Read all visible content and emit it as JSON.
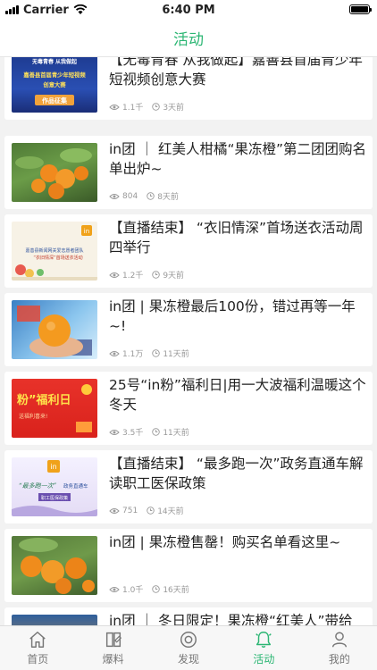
{
  "status": {
    "carrier": "Carrier",
    "time": "6:40 PM"
  },
  "nav": {
    "title": "活动"
  },
  "feed": [
    {
      "title": "【无毒青春 从我做起】嘉善县首届青少年短视频创意大赛",
      "views": "1.1千",
      "time": "3天前"
    },
    {
      "title": "in团 ｜ 红美人柑橘“果冻橙”第二团团购名单出炉~",
      "views": "804",
      "time": "8天前"
    },
    {
      "title": "【直播结束】 “衣旧情深”首场送衣活动周四举行",
      "views": "1.2千",
      "time": "9天前"
    },
    {
      "title": "in团 | 果冻橙最后100份，错过再等一年~!",
      "views": "1.1万",
      "time": "11天前"
    },
    {
      "title": "25号“in粉”福利日|用一大波福利温暖这个冬天",
      "views": "3.5千",
      "time": "11天前"
    },
    {
      "title": "【直播结束】 “最多跑一次”政务直通车解读职工医保政策",
      "views": "751",
      "time": "14天前"
    },
    {
      "title": "in团 | 果冻橙售罄！购买名单看这里~",
      "views": "1.0千",
      "time": "16天前"
    },
    {
      "title": "in团 ｜ 冬日限定！果冻橙“红美人”带给",
      "views": "",
      "time": ""
    }
  ],
  "thumbs": [
    {
      "kind": "banner-blue",
      "lines": [
        "无毒青春 从我做起",
        "嘉善县首届青少年短视频",
        "创意大赛",
        "作品征集"
      ]
    },
    {
      "kind": "oranges"
    },
    {
      "kind": "flyer",
      "lines": [
        "嘉善县新闻网关爱志愿者团队",
        "“衣旧情深”首场送衣活动"
      ]
    },
    {
      "kind": "hand-orange"
    },
    {
      "kind": "red-poster",
      "lines": [
        "粉”福利日",
        "送福利喜来!"
      ]
    },
    {
      "kind": "flyer2",
      "lines": [
        "“最多跑一次”",
        "政务直通车",
        "职工医保政策"
      ]
    },
    {
      "kind": "oranges2"
    },
    {
      "kind": "partial"
    }
  ],
  "tabs": [
    {
      "label": "首页",
      "icon": "home-icon"
    },
    {
      "label": "爆料",
      "icon": "book-icon"
    },
    {
      "label": "发现",
      "icon": "compass-icon"
    },
    {
      "label": "活动",
      "icon": "bell-icon"
    },
    {
      "label": "我的",
      "icon": "person-icon"
    }
  ],
  "colors": {
    "accent": "#2bb673",
    "background": "#f2f2f2",
    "meta": "#999999"
  }
}
